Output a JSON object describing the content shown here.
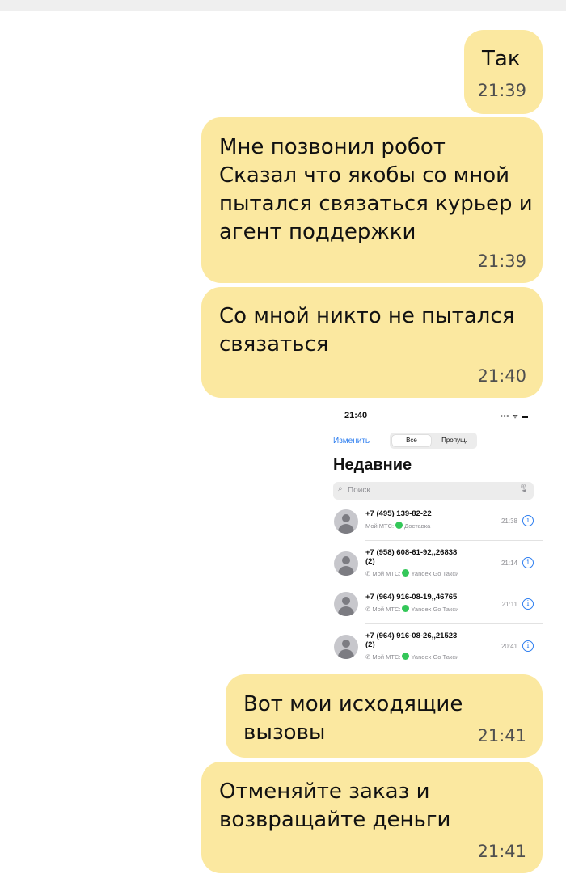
{
  "messages": [
    {
      "text": "Так",
      "time": "21:39"
    },
    {
      "text": "Мне позвонил робот\nСказал что якобы со мной\nпытался связаться курьер и\nагент поддержки",
      "time": "21:39"
    },
    {
      "text": "Со мной никто не пытался\nсвязаться",
      "time": "21:40"
    },
    {
      "text": "Вот мои исходящие вызовы",
      "time": "21:41"
    },
    {
      "text": "Отменяйте заказ и\nвозвращайте деньги",
      "time": "21:41"
    }
  ],
  "screenshot": {
    "clock": "21:40",
    "status": "▪▪▪ ᯤ ▬",
    "edit": "Изменить",
    "seg_all": "Все",
    "seg_missed": "Пропущ.",
    "heading": "Недавние",
    "search_placeholder": "Поиск",
    "calls": [
      {
        "number": "+7 (495) 139-82-22",
        "sub_prefix": "Мой МТС:",
        "sub_label": "Доставка",
        "time": "21:38"
      },
      {
        "number": "+7 (958) 608-61-92,,26838\n(2)",
        "sub_prefix": "✆ Мой МТС:",
        "sub_label": "Yandex Go Такси",
        "time": "21:14"
      },
      {
        "number": "+7 (964) 916-08-19,,46765",
        "sub_prefix": "✆ Мой МТС:",
        "sub_label": "Yandex Go Такси",
        "time": "21:11"
      },
      {
        "number": "+7 (964) 916-08-26,,21523\n(2)",
        "sub_prefix": "✆ Мой МТС:",
        "sub_label": "Yandex Go Такси",
        "time": "20:41"
      }
    ]
  }
}
